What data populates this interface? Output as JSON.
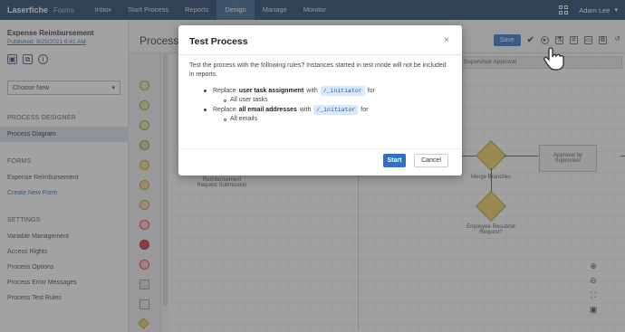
{
  "nav": {
    "brand": "Laserfiche",
    "product": "Forms",
    "items": [
      "Inbox",
      "Start Process",
      "Reports",
      "Design",
      "Manage",
      "Monitor"
    ],
    "active_index": 3,
    "user": "Adam Lee"
  },
  "sidebar": {
    "process_name": "Expense Reimbursement",
    "published": "Published: 9/25/2021 6:41 AM",
    "choose_new": "Choose New",
    "designer_heading": "PROCESS DESIGNER",
    "designer_item": "Process Diagram",
    "forms_heading": "FORMS",
    "forms_items": [
      "Expense Reimbursement",
      "Create New Form"
    ],
    "settings_heading": "SETTINGS",
    "settings_items": [
      "Variable Management",
      "Access Rights",
      "Process Options",
      "Process Error Messages",
      "Process Test Rules"
    ]
  },
  "main": {
    "title": "Process",
    "save_label": "Save",
    "lane_label": "Supervisor Approval",
    "labels": {
      "submit_task": "Reimbursement Request Submission",
      "merge": "Merge Branches",
      "employee_review": "Employee Resubmit Request?",
      "approval_task": "Approval by Supervisor"
    }
  },
  "dialog": {
    "title": "Test Process",
    "intro": "Test the process with the following rules? Instances started in test mode will not be included in reports.",
    "rule1_prefix": "Replace",
    "rule1_bold": "user task assignment",
    "rule1_with": "with",
    "rule1_tag": "/_initiator",
    "rule1_for": "for",
    "rule1_sub": "All user tasks",
    "rule2_prefix": "Replace",
    "rule2_bold": "all email addresses",
    "rule2_with": "with",
    "rule2_tag": "/_initiator",
    "rule2_for": "for",
    "rule2_sub": "All emails",
    "start": "Start",
    "cancel": "Cancel",
    "close_symbol": "×"
  },
  "colors": {
    "nav_bg": "#1f3f67",
    "primary": "#2f6fc4",
    "tag_bg": "#d9e8fb",
    "gateway": "#eccd5a"
  }
}
